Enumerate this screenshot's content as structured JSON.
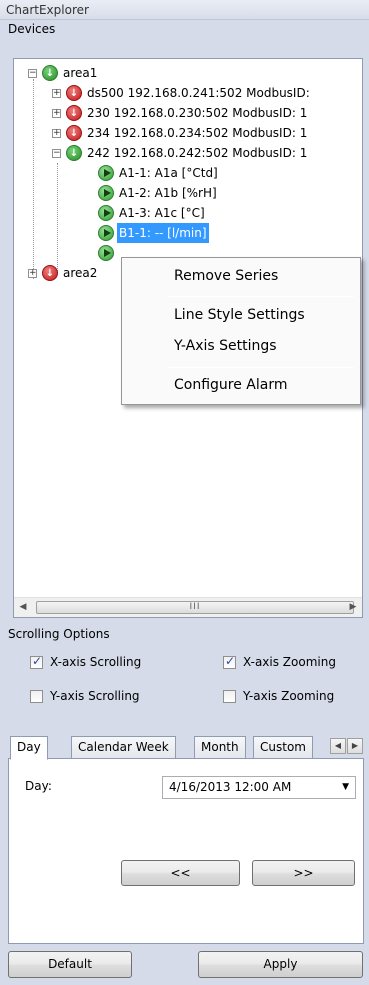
{
  "window": {
    "title": "ChartExplorer"
  },
  "devices": {
    "label": "Devices",
    "tree": {
      "area1": "area1",
      "dev1": "ds500 192.168.0.241:502 ModbusID:",
      "dev2": "230 192.168.0.230:502 ModbusID: 1",
      "dev3": "234 192.168.0.234:502 ModbusID: 1",
      "dev4": "242 192.168.0.242:502 ModbusID: 1",
      "ch1": "A1-1: A1a [°Ctd]",
      "ch2": "A1-2: A1b [%rH]",
      "ch3": "A1-3: A1c [°C]",
      "ch4": "B1-1: -- [l/min]",
      "area2": "area2"
    },
    "scrollbar_grip": "III"
  },
  "context_menu": {
    "items": [
      "Remove Series",
      "Line Style Settings",
      "Y-Axis Settings",
      "Configure Alarm"
    ]
  },
  "scrolling_options": {
    "label": "Scrolling Options",
    "x_scroll": {
      "label": "X-axis Scrolling",
      "checked": true
    },
    "x_zoom": {
      "label": "X-axis Zooming",
      "checked": true
    },
    "y_scroll": {
      "label": "Y-axis Scrolling",
      "checked": false
    },
    "y_zoom": {
      "label": "Y-axis Zooming",
      "checked": false
    }
  },
  "tabs": {
    "items": [
      "Day",
      "Calendar Week",
      "Month",
      "Custom"
    ],
    "active": "Day"
  },
  "day_panel": {
    "day_label": "Day:",
    "day_value": "4/16/2013 12:00 AM",
    "prev_label": "<<",
    "next_label": ">>"
  },
  "footer": {
    "default_label": "Default",
    "apply_label": "Apply"
  },
  "colors": {
    "selection": "#3399ff",
    "status_ok": "#1e8f1e",
    "status_error": "#c01818"
  }
}
